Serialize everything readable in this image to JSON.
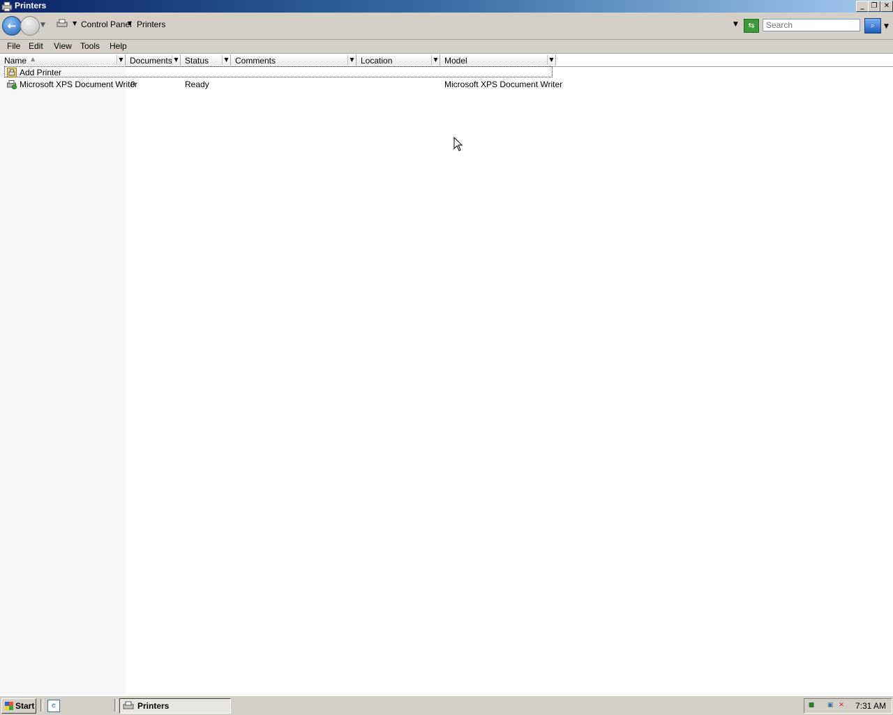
{
  "window": {
    "title": "Printers",
    "buttons": {
      "minimize": "_",
      "restore": "❐",
      "close": "✕"
    }
  },
  "address_bar": {
    "breadcrumbs": [
      "Control Panel",
      "Printers"
    ],
    "search_placeholder": "Search"
  },
  "menu": [
    "File",
    "Edit",
    "View",
    "Tools",
    "Help"
  ],
  "columns": [
    "Name",
    "Documents",
    "Status",
    "Comments",
    "Location",
    "Model"
  ],
  "rows": [
    {
      "name": "Add Printer",
      "documents": "",
      "status": "",
      "comments": "",
      "location": "",
      "model": ""
    },
    {
      "name": "Microsoft XPS Document Writer",
      "documents": "0",
      "status": "Ready",
      "comments": "",
      "location": "",
      "model": "Microsoft XPS Document Writer"
    }
  ],
  "taskbar": {
    "start_label": "Start",
    "task_label": "Printers",
    "clock": "7:31 AM"
  },
  "icons": {
    "window": "printer-folder-icon",
    "back": "back-arrow-icon",
    "forward": "forward-arrow-icon",
    "refresh": "refresh-icon",
    "search": "search-icon",
    "add_printer": "add-printer-icon",
    "printer": "printer-icon"
  },
  "colors": {
    "title_gradient_start": "#0a246a",
    "title_gradient_end": "#a6caf0",
    "chrome": "#d4d0c8",
    "name_column_bg": "#f7f7f7"
  }
}
